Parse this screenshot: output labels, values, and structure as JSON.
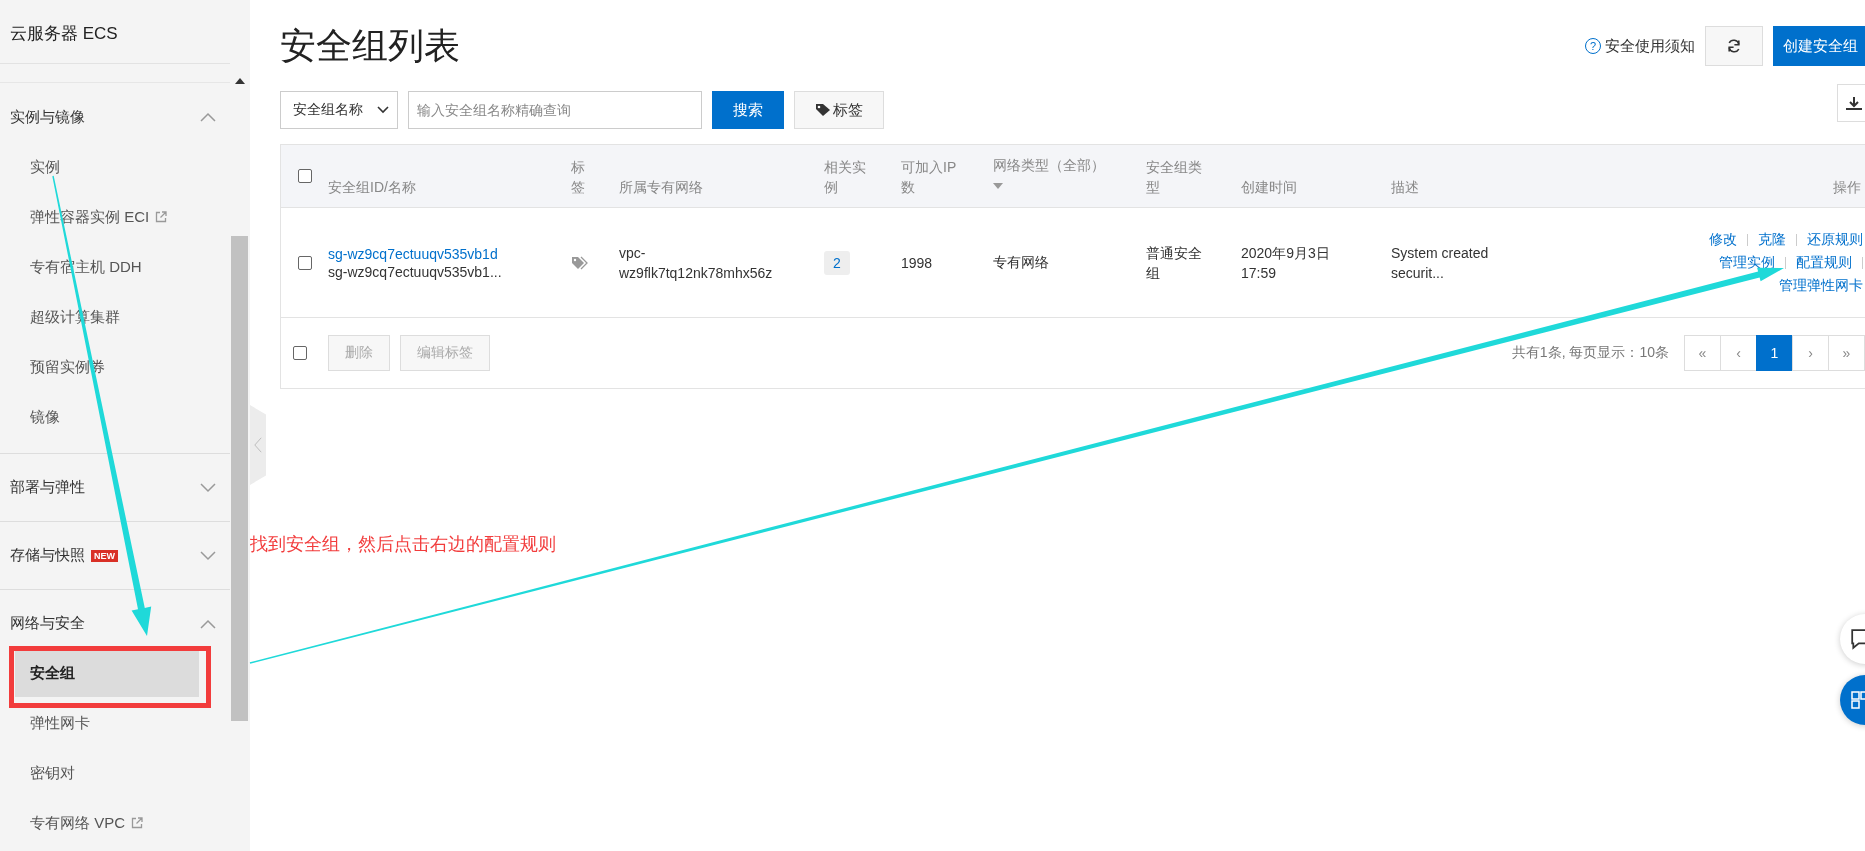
{
  "sidebar": {
    "title": "云服务器 ECS",
    "sections": [
      {
        "label": "实例与镜像",
        "expanded": true,
        "children": [
          {
            "label": "实例",
            "selected": false
          },
          {
            "label": "弹性容器实例 ECI",
            "selected": false,
            "external": true
          },
          {
            "label": "专有宿主机 DDH",
            "selected": false
          },
          {
            "label": "超级计算集群",
            "selected": false
          },
          {
            "label": "预留实例券",
            "selected": false
          },
          {
            "label": "镜像",
            "selected": false
          }
        ]
      },
      {
        "label": "部署与弹性",
        "expanded": false
      },
      {
        "label": "存储与快照",
        "expanded": false,
        "badge": "NEW"
      },
      {
        "label": "网络与安全",
        "expanded": true,
        "children": [
          {
            "label": "安全组",
            "selected": true
          },
          {
            "label": "弹性网卡",
            "selected": false
          },
          {
            "label": "密钥对",
            "selected": false
          },
          {
            "label": "专有网络 VPC",
            "selected": false,
            "external": true
          }
        ]
      }
    ]
  },
  "page": {
    "title": "安全组列表",
    "help_icon": "?",
    "help_link": "安全使用须知",
    "create_button": "创建安全组"
  },
  "search": {
    "filter": "安全组名称",
    "placeholder": "输入安全组名称精确查询",
    "search_button": "搜索",
    "tag_button": "标签"
  },
  "table": {
    "header_checked": false,
    "columns": [
      "安全组ID/名称",
      "标签",
      "所属专有网络",
      "相关实例",
      "可加入IP数",
      "网络类型（全部）",
      "安全组类型",
      "创建时间",
      "描述",
      "操作"
    ],
    "rows": [
      {
        "checked": false,
        "id": "sg-wz9cq7ectuuqv535vb1d",
        "name": "sg-wz9cq7ectuuqv535vb1...",
        "vpc": "vpc-wz9flk7tq12nk78mhx56z",
        "instances": "2",
        "ip_count": "1998",
        "network_type": "专有网络",
        "group_type": "普通安全组",
        "created": "2020年9月3日 17:59",
        "description": "System created securit...",
        "actions": [
          [
            "修改",
            "克隆",
            "还原规则"
          ],
          [
            "管理实例",
            "配置规则"
          ],
          [
            "管理弹性网卡"
          ]
        ]
      }
    ],
    "footer_checked": false,
    "bulk_buttons": [
      "删除",
      "编辑标签"
    ]
  },
  "pagination": {
    "summary": "共有1条, 每页显示：10条",
    "buttons": [
      {
        "label": "«",
        "selected": false
      },
      {
        "label": "‹",
        "selected": false
      },
      {
        "label": "1",
        "selected": true
      },
      {
        "label": "›",
        "selected": false
      },
      {
        "label": "»",
        "selected": false
      }
    ]
  },
  "annotation": {
    "text": "找到安全组，然后点击右边的配置规则"
  }
}
